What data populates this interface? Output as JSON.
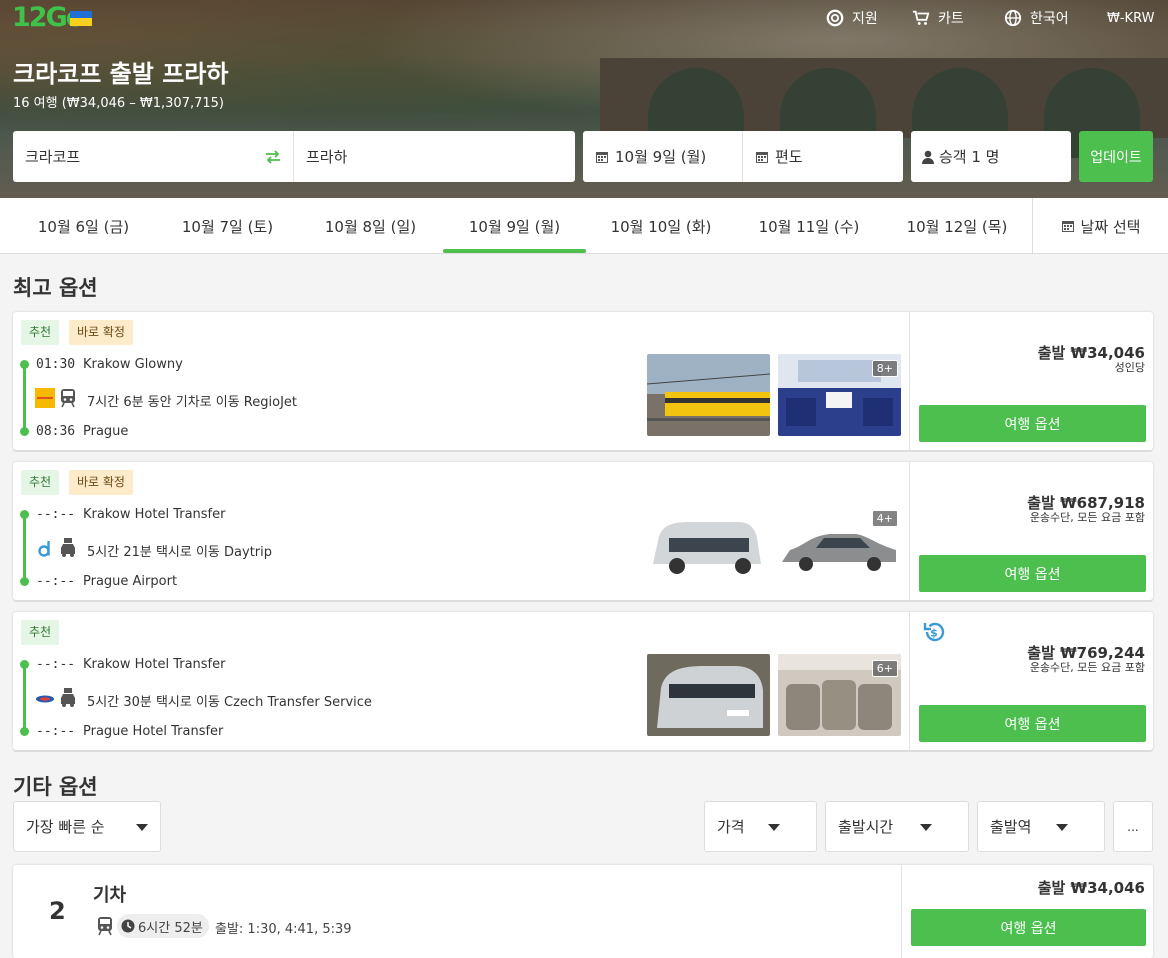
{
  "brand": {
    "logo_text": "12Go",
    "green": "#4cbf4f"
  },
  "topnav": {
    "support": "지원",
    "cart": "카트",
    "language": "한국어",
    "currency": "₩-KRW"
  },
  "hero": {
    "title": "크라코프 출발 프라하",
    "subtitle": "16 여행 (₩34,046 – ₩1,307,715)"
  },
  "search": {
    "from": "크라코프",
    "to": "프라하",
    "date": "10월 9일 (월)",
    "trip": "편도",
    "passengers": "승객 1 명",
    "update": "업데이트"
  },
  "date_tabs": [
    {
      "label": "10월 6일 (금)"
    },
    {
      "label": "10월 7일 (토)"
    },
    {
      "label": "10월 8일 (일)"
    },
    {
      "label": "10월 9일 (월)",
      "active": true
    },
    {
      "label": "10월 10일 (화)"
    },
    {
      "label": "10월 11일 (수)"
    },
    {
      "label": "10월 12일 (목)"
    }
  ],
  "date_picker": "날짜 선택",
  "best_title": "최고 옵션",
  "options": [
    {
      "badges": [
        "추천",
        "바로 확정"
      ],
      "dep_time": "01:30",
      "dep_place": "Krakow Glowny",
      "description": "7시간 6분 동안 기차로 이동 RegioJet",
      "arr_time": "08:36",
      "arr_place": "Prague",
      "more_photos": "8+",
      "price": "출발 ₩34,046",
      "price_note": "성인당",
      "button": "여행 옵션"
    },
    {
      "badges": [
        "추천",
        "바로 확정"
      ],
      "dep_time": "--:--",
      "dep_place": "Krakow Hotel Transfer",
      "description": "5시간 21분 택시로 이동 Daytrip",
      "arr_time": "--:--",
      "arr_place": "Prague Airport",
      "more_photos": "4+",
      "price": "출발 ₩687,918",
      "price_note": "운송수단, 모든 요금 포함",
      "button": "여행 옵션"
    },
    {
      "badges": [
        "추천"
      ],
      "dep_time": "--:--",
      "dep_place": "Krakow Hotel Transfer",
      "description": "5시간 30분 택시로 이동 Czech Transfer Service",
      "arr_time": "--:--",
      "arr_place": "Prague Hotel Transfer",
      "more_photos": "6+",
      "price": "출발 ₩769,244",
      "price_note": "운송수단, 모든 요금 포함",
      "button": "여행 옵션"
    }
  ],
  "other_title": "기타 옵션",
  "filters": {
    "sort": "가장 빠른 순",
    "price": "가격",
    "departure_time": "출발시간",
    "station": "출발역",
    "more": "..."
  },
  "other": {
    "count": "2",
    "type": "기차",
    "duration": "6시간 52분",
    "departures": "출발: 1:30, 4:41, 5:39",
    "price": "출발 ₩34,046",
    "button": "여행 옵션"
  }
}
